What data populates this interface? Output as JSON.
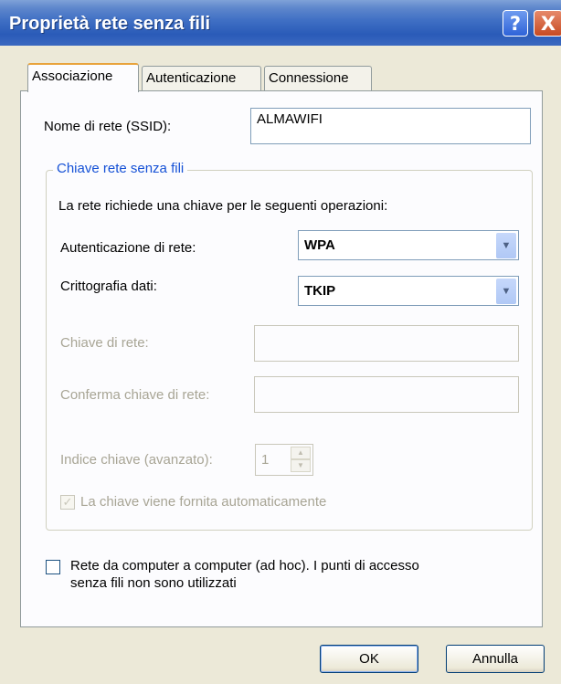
{
  "window": {
    "title": "Proprietà rete senza fili",
    "help_icon": "question-mark-icon",
    "help_label": "?",
    "close_icon": "close-icon",
    "close_label": "X",
    "titlebar_color": "#2a5bb8"
  },
  "tabs": [
    {
      "label": "Associazione",
      "active": true
    },
    {
      "label": "Autenticazione",
      "active": false
    },
    {
      "label": "Connessione",
      "active": false
    }
  ],
  "association": {
    "ssid_label": "Nome di rete (SSID):",
    "ssid_value": "ALMAWIFI",
    "group_title": "Chiave rete senza fili",
    "key_requirement_text": "La rete richiede una chiave per le seguenti operazioni:",
    "auth_label": "Autenticazione di rete:",
    "auth_value": "WPA",
    "encryption_label": "Crittografia dati:",
    "encryption_value": "TKIP",
    "network_key_label": "Chiave di rete:",
    "network_key_value": "",
    "confirm_key_label": "Conferma chiave di rete:",
    "confirm_key_value": "",
    "key_index_label": "Indice chiave (avanzato):",
    "key_index_value": "1",
    "auto_key_label": "La chiave viene fornita automaticamente",
    "auto_key_checked": true,
    "adhoc_label_line1": "Rete da computer a computer (ad hoc). I punti di accesso",
    "adhoc_label_line2": "senza fili non sono utilizzati",
    "adhoc_checked": false
  },
  "buttons": {
    "ok": "OK",
    "cancel": "Annulla"
  },
  "colors": {
    "group_title": "#1551d6",
    "tab_highlight": "#e8a33c",
    "disabled_text": "#a8a595"
  }
}
